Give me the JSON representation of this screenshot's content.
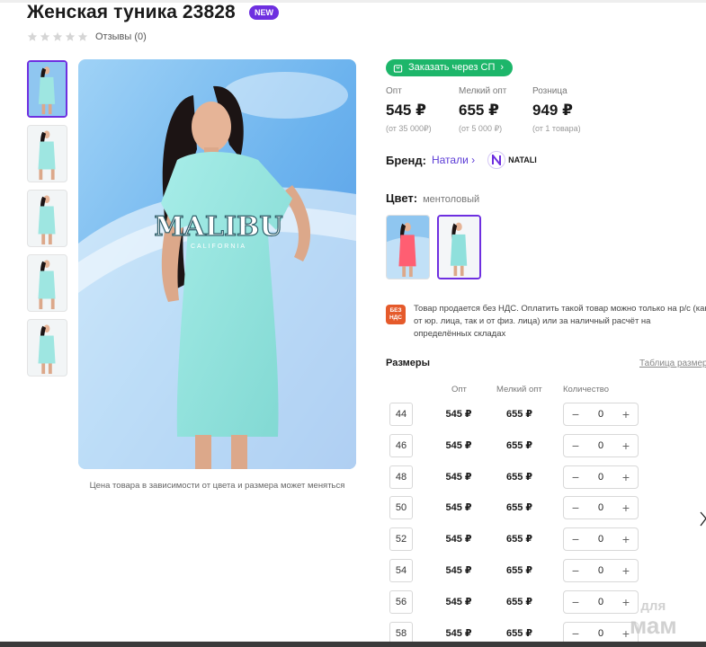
{
  "product": {
    "title": "Женская туника 23828",
    "badge": "NEW",
    "reviews": "Отзывы (0)",
    "rating": 0,
    "rating_max": 5
  },
  "gallery": {
    "thumbnails": [
      "thumb-1",
      "thumb-2",
      "thumb-3",
      "thumb-4",
      "thumb-5"
    ],
    "active_index": 0,
    "main_print": "MALIBU",
    "main_print_sub": "CALIFORNIA",
    "note": "Цена товара в зависимости от цвета и размера может меняться"
  },
  "purchase": {
    "sp_button": "Заказать через СП",
    "prices": [
      {
        "label": "Опт",
        "value": "545 ₽",
        "sub": "(от 35 000₽)"
      },
      {
        "label": "Мелкий опт",
        "value": "655 ₽",
        "sub": "(от 5 000 ₽)"
      },
      {
        "label": "Розница",
        "value": "949 ₽",
        "sub": "(от 1 товара)"
      }
    ]
  },
  "brand": {
    "label": "Бренд:",
    "name": "Натали",
    "logo_text": "NATALI"
  },
  "color": {
    "label": "Цвет:",
    "value": "ментоловый",
    "swatches": [
      "coral",
      "mint"
    ],
    "selected": 1
  },
  "vat": {
    "icon_line1": "БЕЗ",
    "icon_line2": "НДС",
    "text": "Товар продается без НДС. Оплатить такой товар можно только на р/с (как от юр. лица, так и от физ. лица) или за наличный расчёт на определённых складах"
  },
  "sizes": {
    "title": "Размеры",
    "table_link": "Таблица размер",
    "headers": {
      "opt": "Опт",
      "small": "Мелкий опт",
      "qty": "Количество"
    },
    "rows": [
      {
        "size": "44",
        "opt": "545 ₽",
        "small": "655 ₽",
        "qty": "0"
      },
      {
        "size": "46",
        "opt": "545 ₽",
        "small": "655 ₽",
        "qty": "0"
      },
      {
        "size": "48",
        "opt": "545 ₽",
        "small": "655 ₽",
        "qty": "0"
      },
      {
        "size": "50",
        "opt": "545 ₽",
        "small": "655 ₽",
        "qty": "0"
      },
      {
        "size": "52",
        "opt": "545 ₽",
        "small": "655 ₽",
        "qty": "0"
      },
      {
        "size": "54",
        "opt": "545 ₽",
        "small": "655 ₽",
        "qty": "0"
      },
      {
        "size": "56",
        "opt": "545 ₽",
        "small": "655 ₽",
        "qty": "0"
      },
      {
        "size": "58",
        "opt": "545 ₽",
        "small": "655 ₽",
        "qty": "0"
      }
    ],
    "minus": "−",
    "plus": "+"
  },
  "watermark": {
    "line1": "для",
    "line2": "мам"
  },
  "colors": {
    "accent": "#6e2fe0",
    "green": "#1db66a",
    "mint": "#8fe0dc",
    "coral": "#ff5e72",
    "vat": "#e55a2b"
  }
}
